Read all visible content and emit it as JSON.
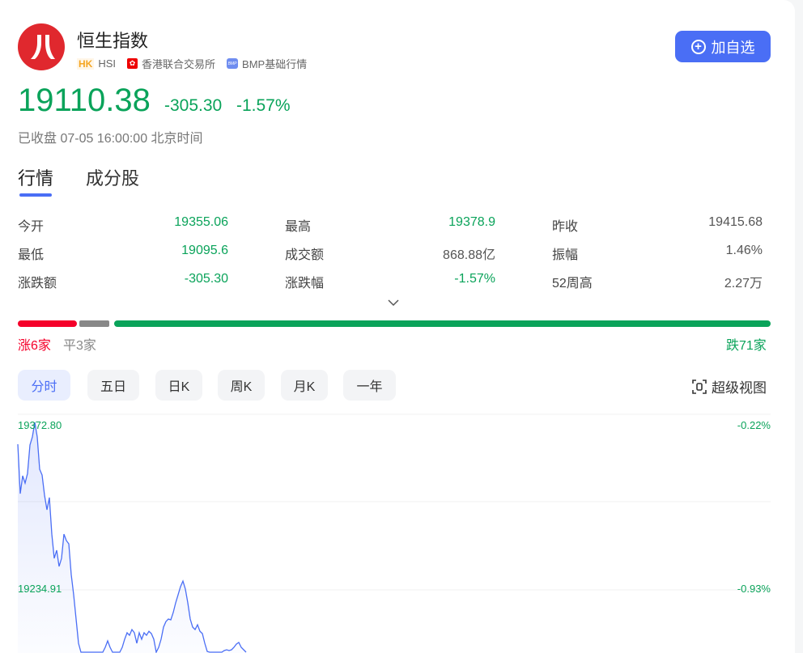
{
  "header": {
    "title": "恒生指数",
    "market_badge": "HK",
    "code": "HSI",
    "exchange": "香港联合交易所",
    "data_source": "BMP基础行情",
    "bmp_icon_text": "BMP",
    "add_button": "加自选",
    "logo_icon": "hang-seng-logo"
  },
  "quote": {
    "price": "19110.38",
    "change": "-305.30",
    "change_pct": "-1.57%",
    "status": "已收盘 07-05 16:00:00 北京时间"
  },
  "tabs": [
    {
      "label": "行情",
      "active": true
    },
    {
      "label": "成分股",
      "active": false
    }
  ],
  "stats": [
    [
      {
        "label": "今开",
        "value": "19355.06",
        "color": "green"
      },
      {
        "label": "最高",
        "value": "19378.9",
        "color": "green"
      },
      {
        "label": "昨收",
        "value": "19415.68",
        "color": "neutral"
      }
    ],
    [
      {
        "label": "最低",
        "value": "19095.6",
        "color": "green"
      },
      {
        "label": "成交额",
        "value": "868.88亿",
        "color": "neutral"
      },
      {
        "label": "振幅",
        "value": "1.46%",
        "color": "neutral"
      }
    ],
    [
      {
        "label": "涨跌额",
        "value": "-305.30",
        "color": "green"
      },
      {
        "label": "涨跌幅",
        "value": "-1.57%",
        "color": "green"
      },
      {
        "label": "52周高",
        "value": "2.27万",
        "color": "neutral"
      }
    ]
  ],
  "breadth": {
    "up_label": "涨6家",
    "flat_label": "平3家",
    "down_label": "跌71家",
    "up": 6,
    "flat": 3,
    "down": 71,
    "colors": {
      "up": "#f5002a",
      "flat": "#888888",
      "down": "#0aa35a"
    }
  },
  "periods": [
    {
      "label": "分时",
      "active": true
    },
    {
      "label": "五日"
    },
    {
      "label": "日K"
    },
    {
      "label": "周K"
    },
    {
      "label": "月K"
    },
    {
      "label": "一年"
    }
  ],
  "super_view": "超级视图",
  "chart_data": {
    "type": "area",
    "title": "",
    "y_tick_labels": [
      "19372.80",
      "19234.91"
    ],
    "y_tick_values": [
      19372.8,
      19234.91
    ],
    "right_tick_labels": [
      "-0.22%",
      "-0.93%"
    ],
    "ylim": [
      19372.8,
      19097.02
    ],
    "xlim": [
      0,
      310
    ],
    "grid": true,
    "line_color": "#4a6ef5",
    "values": [
      19356.6,
      19315.3,
      19330.2,
      19324.1,
      19332.2,
      19355.9,
      19362.7,
      19374.8,
      19362.7,
      19335.6,
      19330.9,
      19314.0,
      19301.8,
      19312.0,
      19281.5,
      19261.3,
      19268.0,
      19254.5,
      19261.3,
      19281.5,
      19276.1,
      19273.4,
      19247.7,
      19230.8,
      19210.6,
      19190.3,
      19176.8,
      19166.6,
      19163.2,
      19166.6,
      19159.9,
      19163.2,
      19170.0,
      19166.6,
      19173.4,
      19180.1,
      19186.9,
      19192.3,
      19186.9,
      19180.1,
      19176.8,
      19178.8,
      19181.5,
      19186.9,
      19193.7,
      19199.1,
      19197.0,
      19201.8,
      19199.1,
      19190.3,
      19199.1,
      19193.7,
      19199.1,
      19197.0,
      19200.4,
      19198.4,
      19193.7,
      19180.1,
      19186.9,
      19193.7,
      19203.8,
      19208.5,
      19210.6,
      19209.9,
      19216.0,
      19224.1,
      19230.8,
      19237.6,
      19242.3,
      19235.6,
      19224.1,
      19210.6,
      19203.8,
      19201.8,
      19205.8,
      19200.4,
      19198.4,
      19190.3,
      19183.5,
      19178.8,
      19176.8,
      19176.8,
      19178.8,
      19180.1,
      19181.5,
      19184.2,
      19184.9,
      19184.2,
      19184.9,
      19186.9,
      19189.6,
      19191.0,
      19186.9,
      19184.9,
      19180.1
    ]
  }
}
